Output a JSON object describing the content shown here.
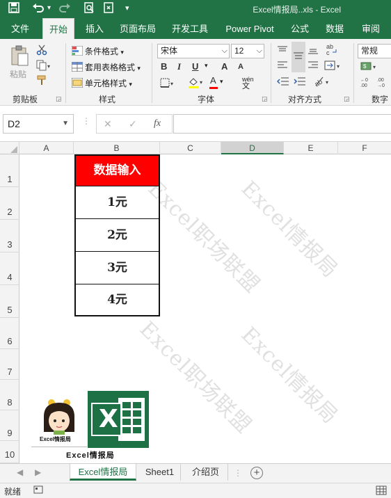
{
  "window": {
    "title": "Excel情报局..xls  -  Excel",
    "quick_access": [
      "save-icon",
      "undo-icon",
      "redo-icon",
      "print-preview-icon",
      "touch-mode-icon",
      "customize-icon"
    ]
  },
  "ribbon": {
    "tabs": [
      "文件",
      "开始",
      "插入",
      "页面布局",
      "开发工具",
      "Power Pivot",
      "公式",
      "数据",
      "审阅"
    ],
    "active_tab": "开始",
    "clipboard": {
      "paste": "粘贴",
      "label": "剪贴板"
    },
    "styles": {
      "conditional": "条件格式",
      "table": "套用表格格式",
      "cell": "单元格样式",
      "label": "样式"
    },
    "font": {
      "name": "宋体",
      "size": "12",
      "label": "字体",
      "bold": "B",
      "italic": "I",
      "underline": "U",
      "grow": "A",
      "shrink": "A",
      "font_color": "A",
      "phonetic": "wén"
    },
    "alignment": {
      "label": "对齐方式"
    },
    "number": {
      "format": "常规",
      "label": "数字"
    },
    "accent_color": "#217346"
  },
  "formula_bar": {
    "name_box": "D2",
    "fx": "fx",
    "content": ""
  },
  "grid": {
    "columns": [
      "A",
      "B",
      "C",
      "D",
      "E",
      "F"
    ],
    "selected_column": "D",
    "rows": [
      "1",
      "2",
      "3",
      "4",
      "5",
      "6",
      "7",
      "8",
      "9",
      "10"
    ],
    "table": {
      "header": "数据输入",
      "cells": [
        "1元",
        "2元",
        "3元",
        "4元"
      ],
      "header_color": "#ff0000"
    },
    "watermarks": [
      "Excel职场联盟",
      "Excel情报局",
      "Excel职场联盟",
      "Excel情报局"
    ]
  },
  "logo": {
    "caption": "Excel情报局",
    "badge": "Excel情报局",
    "excel_letter": "X"
  },
  "sheets": {
    "tabs": [
      "Excel情报局",
      "Sheet1",
      "介绍页"
    ],
    "active": "Excel情报局"
  },
  "status": {
    "text": "就绪"
  }
}
